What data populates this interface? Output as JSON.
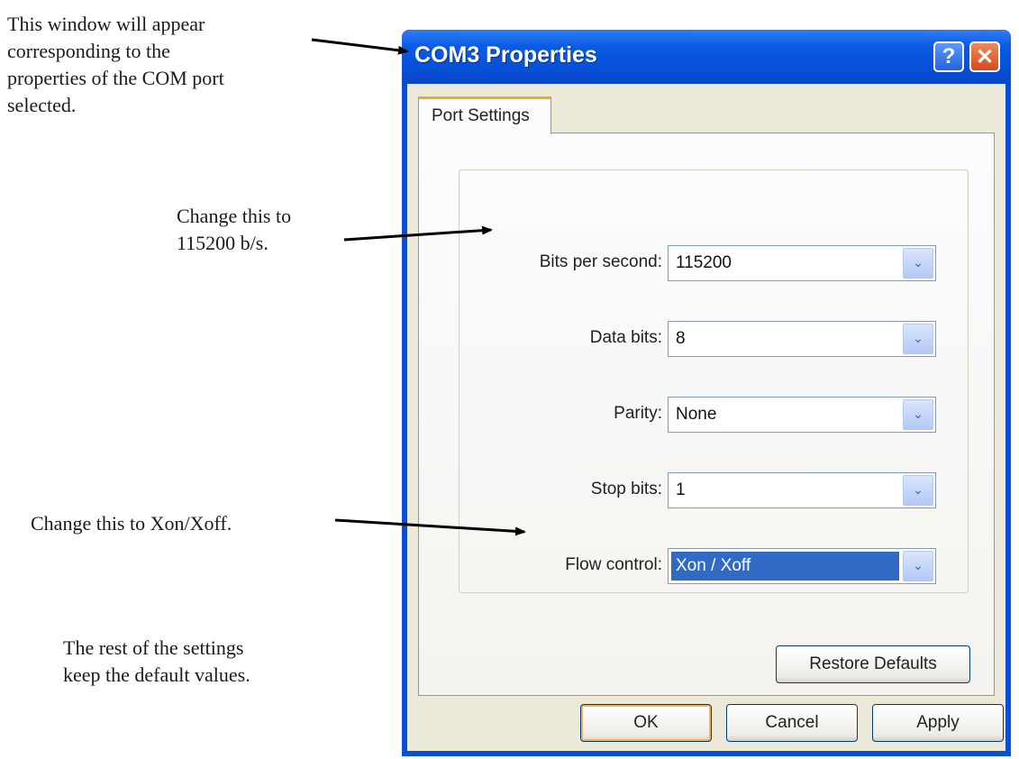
{
  "annotations": {
    "window_note": "This window will appear\ncorresponding to the\nproperties of the COM port\nselected.",
    "bps_note": "Change this to\n115200 b/s.",
    "flow_note": "Change this to Xon/Xoff.",
    "rest_note": "The rest of the settings\nkeep the default values."
  },
  "dialog": {
    "title": "COM3 Properties",
    "help_glyph": "?",
    "close_glyph": "✕",
    "tab_label": "Port Settings",
    "fields": [
      {
        "label": "Bits per second:",
        "value": "115200"
      },
      {
        "label": "Data bits:",
        "value": "8"
      },
      {
        "label": "Parity:",
        "value": "None"
      },
      {
        "label": "Stop bits:",
        "value": "1"
      },
      {
        "label": "Flow control:",
        "value": "Xon / Xoff"
      }
    ],
    "dropdown_glyph": "⌄",
    "restore_label": "Restore Defaults",
    "ok_label": "OK",
    "cancel_label": "Cancel",
    "apply_label": "Apply"
  },
  "colors": {
    "titlebar": "#0a4fd8",
    "selection": "#316ac5",
    "tab_accent": "#f5a623",
    "close": "#d44a1c"
  }
}
